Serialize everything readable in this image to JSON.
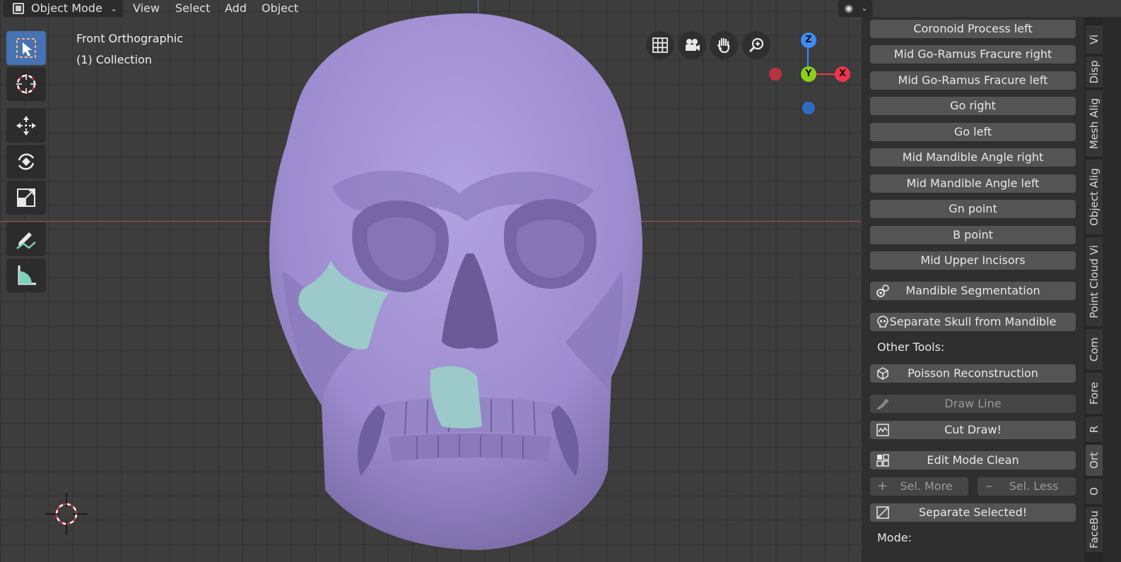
{
  "header": {
    "mode": "Object Mode",
    "menus": [
      "View",
      "Select",
      "Add",
      "Object"
    ]
  },
  "viewport": {
    "view_name": "Front Orthographic",
    "collection": "(1) Collection",
    "gizmo": {
      "z": "Z",
      "y": "Y",
      "x": "X"
    },
    "colors": {
      "skull": "#a898d8",
      "segment": "#9cc8c8",
      "x_axis": "#f0354a",
      "y_axis": "#8bd01b",
      "z_axis": "#3f8cf5"
    }
  },
  "panel": {
    "buttons": [
      "Coronoid Process left",
      "Mid Go-Ramus Fracure right",
      "Mid Go-Ramus Fracure left",
      "Go right",
      "Go left",
      "Mid Mandible Angle right",
      "Mid Mandible Angle left",
      "Gn point",
      "B point",
      "Mid Upper Incisors"
    ],
    "mandible_segmentation": "Mandible Segmentation",
    "separate_skull": "Separate Skull from Mandible",
    "other_tools": "Other Tools:",
    "poisson": "Poisson Reconstruction",
    "draw_line": "Draw Line",
    "cut_draw": "Cut Draw!",
    "edit_mode_clean": "Edit Mode Clean",
    "sel_more": "Sel. More",
    "sel_less": "Sel. Less",
    "separate_selected": "Separate Selected!",
    "mode_label": "Mode:"
  },
  "tabs": [
    "Vi",
    "Disp",
    "Mesh Alig",
    "Object Alig",
    "Point Cloud Vi",
    "Com",
    "Fore",
    "R",
    "Ort",
    "O",
    "FaceBu"
  ]
}
